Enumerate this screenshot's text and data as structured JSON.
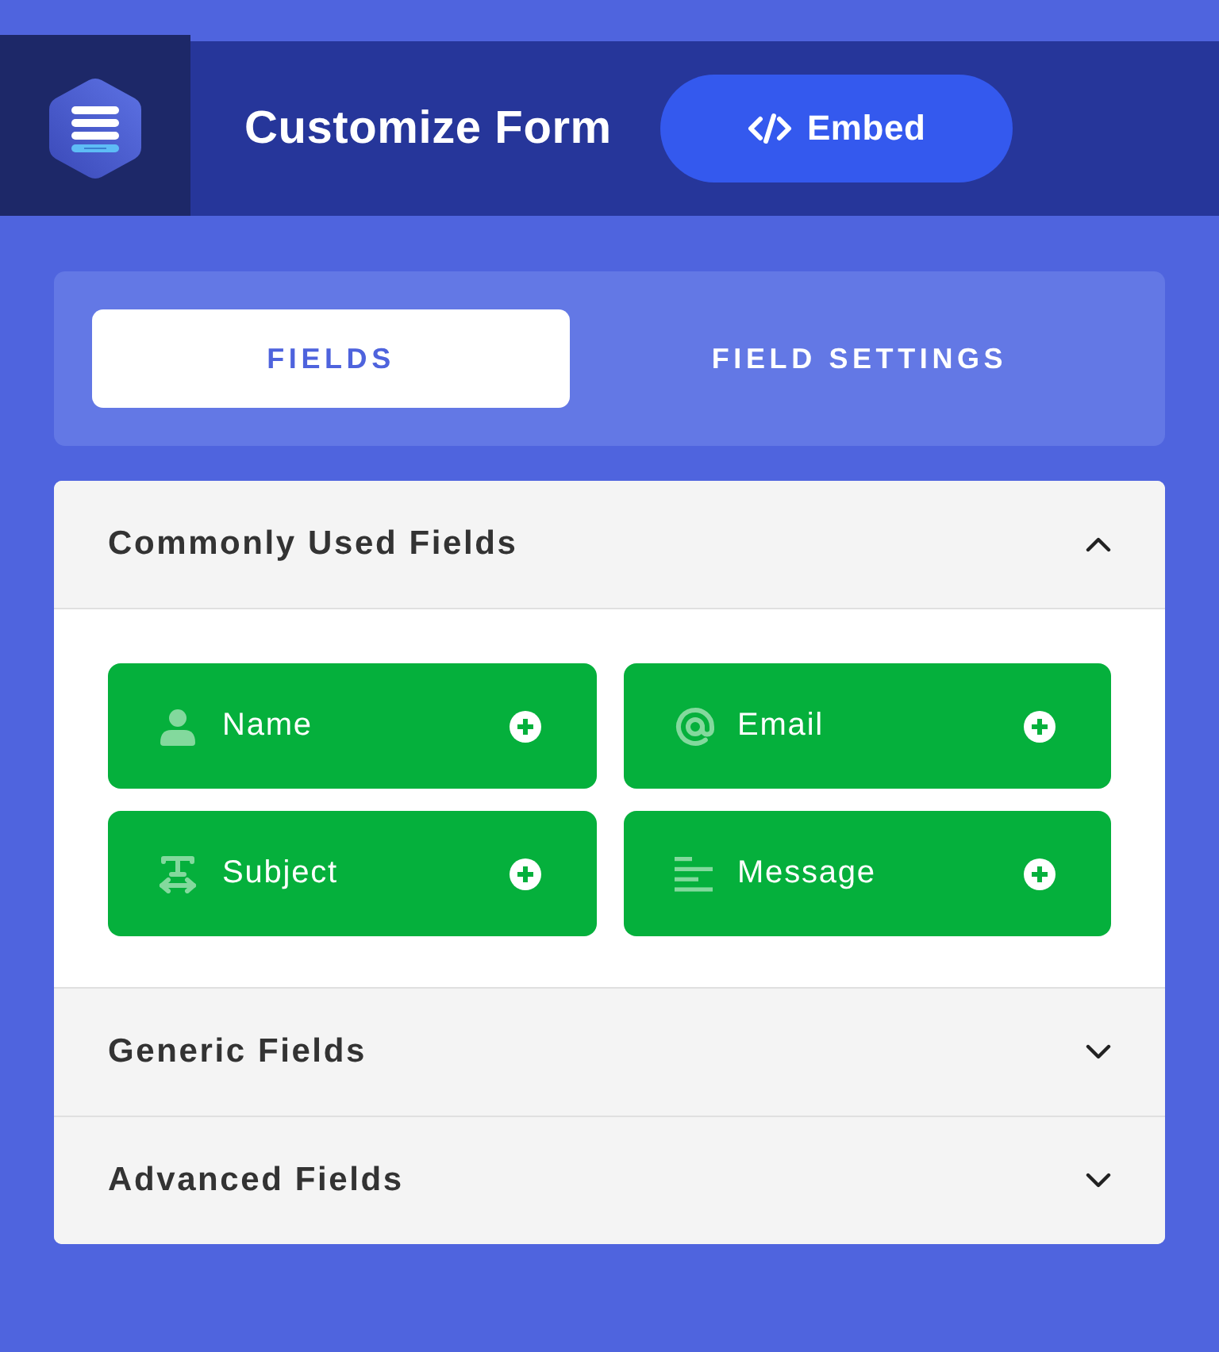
{
  "header": {
    "title": "Customize Form",
    "embed_button": {
      "label": "Embed"
    }
  },
  "tabs": [
    {
      "label": "FIELDS",
      "selected": true
    },
    {
      "label": "FIELD SETTINGS",
      "selected": false
    }
  ],
  "sections": [
    {
      "title": "Commonly Used Fields",
      "expanded": true,
      "fields": [
        {
          "label": "Name",
          "kind": "name"
        },
        {
          "label": "Email",
          "kind": "email"
        },
        {
          "label": "Subject",
          "kind": "subject"
        },
        {
          "label": "Message",
          "kind": "message"
        }
      ]
    },
    {
      "title": "Generic Fields",
      "expanded": false
    },
    {
      "title": "Advanced Fields",
      "expanded": false
    }
  ]
}
